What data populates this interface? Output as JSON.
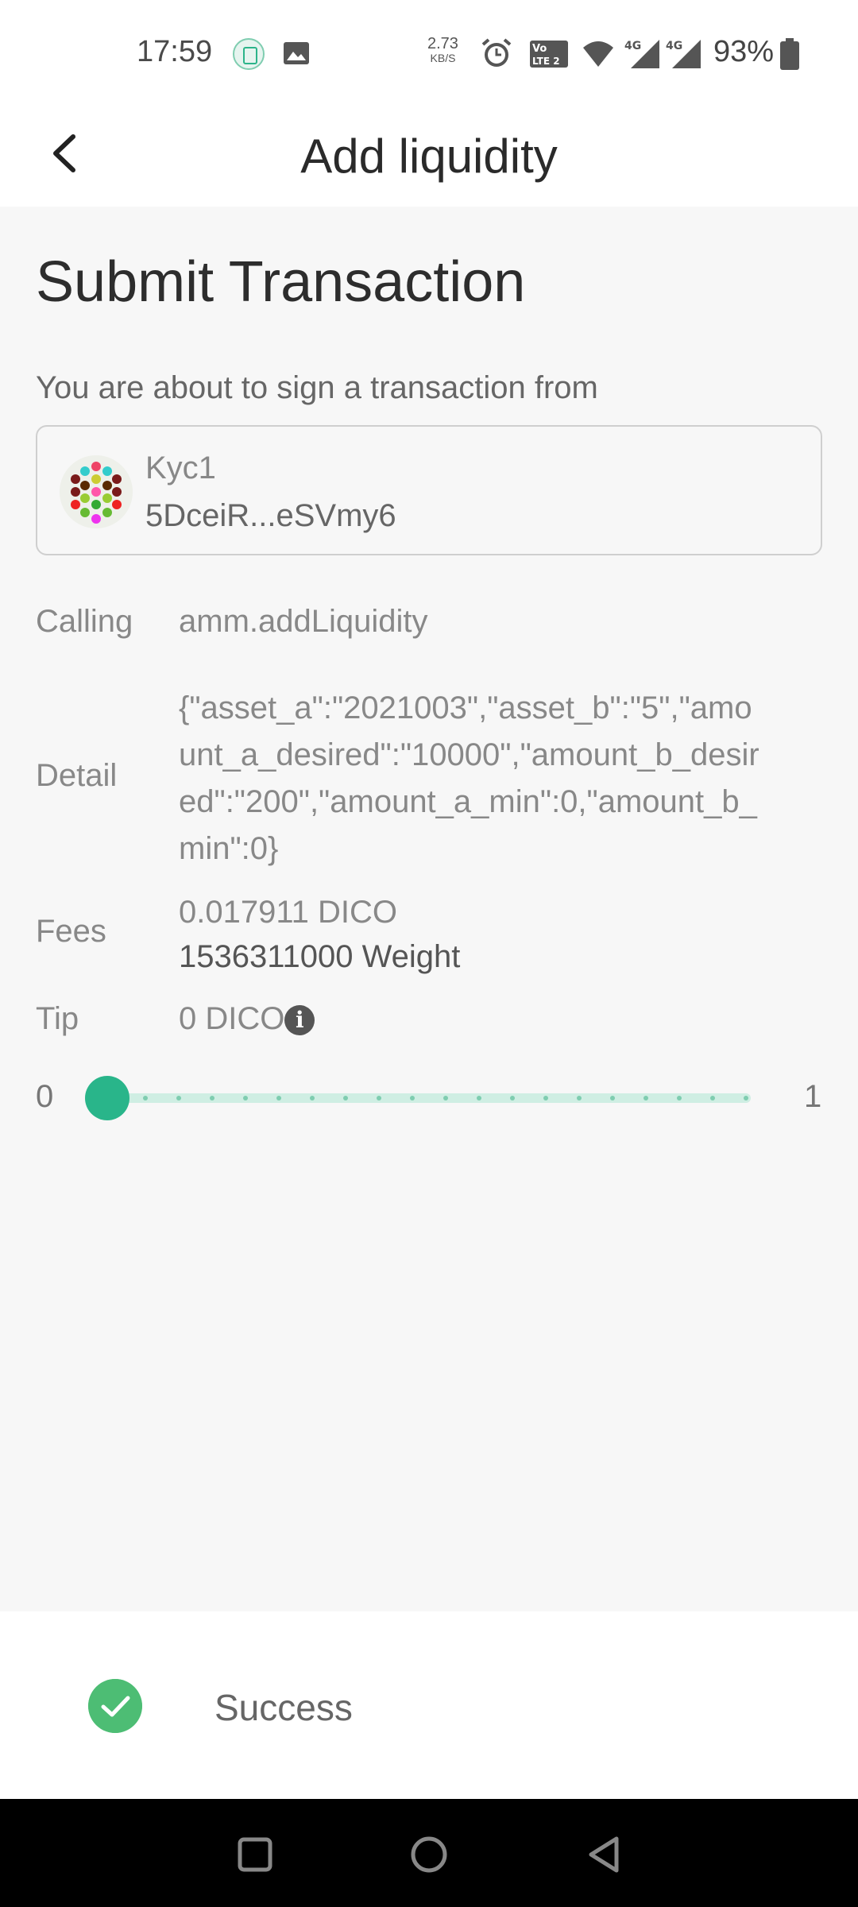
{
  "status_bar": {
    "time": "17:59",
    "net_speed_value": "2.73",
    "net_speed_unit": "KB/S",
    "battery": "93%",
    "icons": [
      "app-notification-icon",
      "gallery-icon",
      "alarm-icon",
      "volte-icon",
      "wifi-icon",
      "signal-4g-icon",
      "signal-4g-icon",
      "battery-icon"
    ]
  },
  "header": {
    "title": "Add liquidity",
    "back_icon": "chevron-left-icon"
  },
  "main": {
    "heading": "Submit Transaction",
    "subtitle": "You are about to sign a transaction from",
    "account": {
      "name": "Kyc1",
      "address": "5DceiR...eSVmy6"
    },
    "rows": {
      "calling_label": "Calling",
      "calling_value": "amm.addLiquidity",
      "detail_label": "Detail",
      "detail_value": "{\"asset_a\":\"2021003\",\"asset_b\":\"5\",\"amount_a_desired\":\"10000\",\"amount_b_desired\":\"200\",\"amount_a_min\":0,\"amount_b_min\":0}",
      "fees_label": "Fees",
      "fees_value": "0.017911 DICO",
      "fees_weight": "1536311000 Weight",
      "tip_label": "Tip",
      "tip_value": "0 DICO",
      "tip_info_icon": "info-icon"
    },
    "slider": {
      "min": "0",
      "max": "1",
      "value": 0
    }
  },
  "toast": {
    "message": "Success",
    "icon": "check-circle-icon"
  },
  "nav": {
    "icons": [
      "recents-square-icon",
      "home-circle-icon",
      "back-triangle-icon"
    ]
  },
  "colors": {
    "accent": "#29b58a",
    "track": "#cfeee3",
    "success": "#4dbd74",
    "background": "#f7f7f7"
  }
}
